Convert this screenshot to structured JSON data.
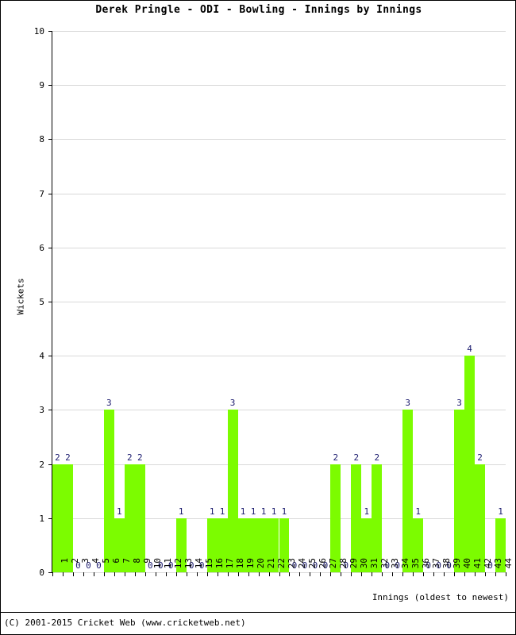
{
  "chart_data": {
    "type": "bar",
    "title": "Derek Pringle - ODI - Bowling - Innings by Innings",
    "xlabel": "Innings (oldest to newest)",
    "ylabel": "Wickets",
    "ylim": [
      0,
      10
    ],
    "ytick_labels": [
      "0",
      "1",
      "2",
      "3",
      "4",
      "5",
      "6",
      "7",
      "8",
      "9",
      "10"
    ],
    "grid": true,
    "legend": null,
    "bar_color": "#7CFC00",
    "label_color": "#1a1a6e",
    "categories": [
      "1",
      "2",
      "3",
      "4",
      "5",
      "6",
      "7",
      "8",
      "9",
      "10",
      "11",
      "12",
      "13",
      "14",
      "15",
      "16",
      "17",
      "18",
      "19",
      "20",
      "21",
      "22",
      "23",
      "24",
      "25",
      "26",
      "27",
      "28",
      "29",
      "30",
      "31",
      "32",
      "33",
      "34",
      "35",
      "36",
      "37",
      "38",
      "39",
      "40",
      "41",
      "42",
      "43",
      "44"
    ],
    "values": [
      2,
      2,
      0,
      0,
      0,
      3,
      1,
      2,
      2,
      0,
      0,
      0,
      1,
      0,
      0,
      1,
      1,
      3,
      1,
      1,
      1,
      1,
      1,
      0,
      0,
      0,
      0,
      2,
      0,
      2,
      1,
      2,
      0,
      0,
      3,
      1,
      0,
      0,
      0,
      3,
      4,
      2,
      0,
      1
    ]
  },
  "footer": {
    "copyright": "(C) 2001-2015 Cricket Web (www.cricketweb.net)"
  }
}
